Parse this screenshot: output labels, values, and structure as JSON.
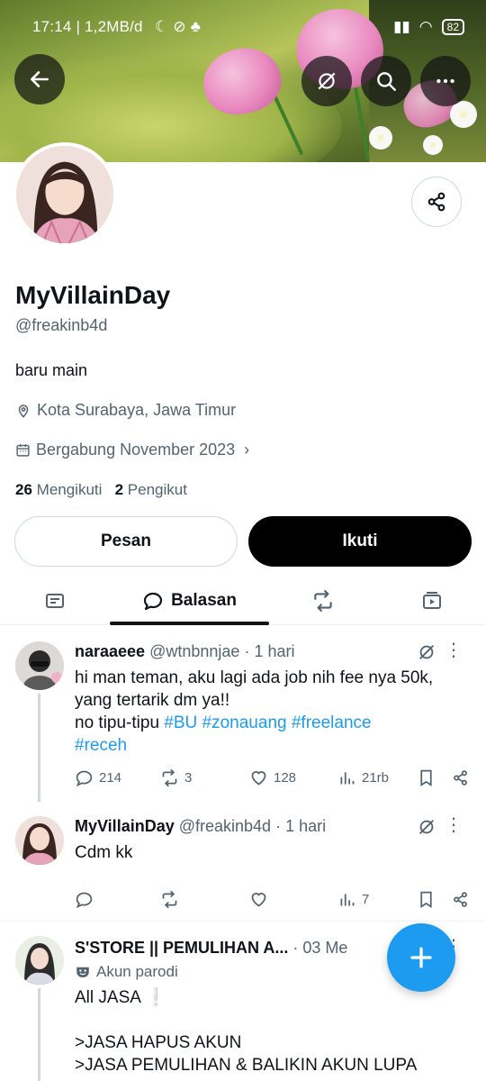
{
  "status_bar": {
    "time_info": "17:14 | 1,2MB/d",
    "battery": "82"
  },
  "profile": {
    "name": "MyVillainDay",
    "handle": "@freakinb4d",
    "bio": "baru main",
    "location": "Kota Surabaya, Jawa Timur",
    "joined": "Bergabung November 2023",
    "following_count": "26",
    "following_label": "Mengikuti",
    "followers_count": "2",
    "followers_label": "Pengikut",
    "message_button": "Pesan",
    "follow_button": "Ikuti"
  },
  "tabs": {
    "active_label": "Balasan"
  },
  "posts": [
    {
      "name": "naraaeee",
      "handle": "@wtnbnnjae",
      "time": "· 1 hari",
      "text_line1": "hi man teman, aku lagi ada job nih fee nya 50k,",
      "text_line2": "yang tertarik dm ya!!",
      "text_line3": "no tipu-tipu",
      "tags_inline": "#BU #zonauang #freelance",
      "tag_last": "#receh",
      "replies": "214",
      "reposts": "3",
      "likes": "128",
      "views": "21rb"
    },
    {
      "name": "MyVillainDay",
      "handle": "@freakinb4d",
      "time": "· 1 hari",
      "text": "Cdm kk",
      "views": "7"
    },
    {
      "name": "S'STORE || PEMULIHAN A...",
      "time": "· 03 Me",
      "badge": "Akun parodi",
      "text_line1": "All JASA ❕",
      "text_line2": ">JASA HAPUS AKUN",
      "text_line3": ">JASA PEMULIHAN & BALIKIN AKUN LUPA"
    }
  ],
  "colors": {
    "accent": "#1d9bf0",
    "text": "#0f1419",
    "secondary": "#536471"
  }
}
